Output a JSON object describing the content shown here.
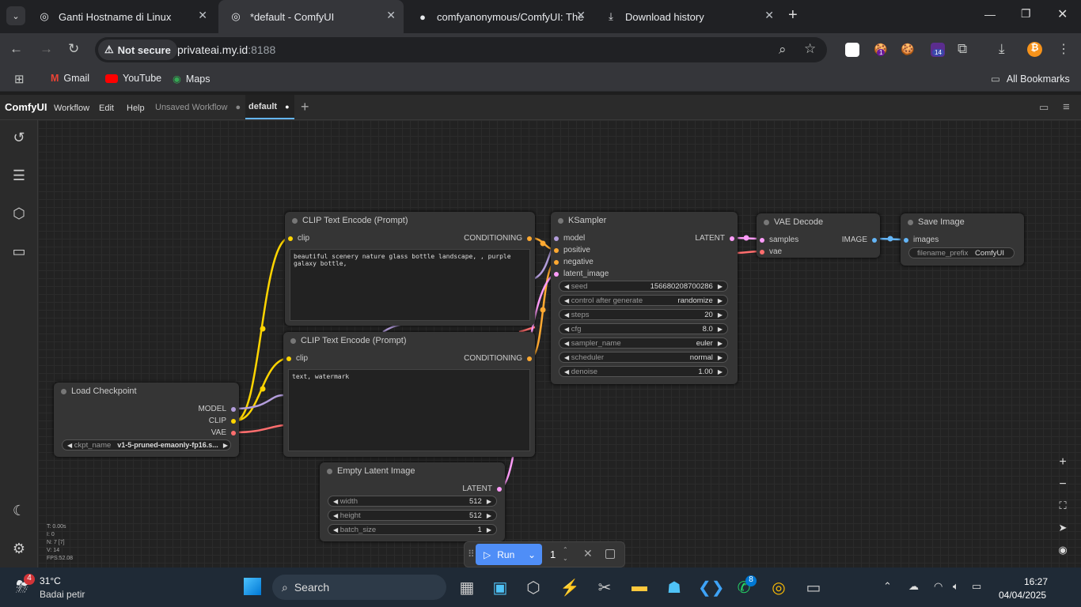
{
  "browser": {
    "tabs": [
      {
        "title": "Ganti Hostname di Linux",
        "active": false
      },
      {
        "title": "*default - ComfyUI",
        "active": true
      },
      {
        "title": "comfyanonymous/ComfyUI: The",
        "active": false
      },
      {
        "title": "Download history",
        "active": false
      }
    ],
    "security": "Not secure",
    "url": "privateai.my.id",
    "port": ":8188",
    "bookmarks": [
      "Gmail",
      "YouTube",
      "Maps"
    ],
    "all_bookmarks": "All Bookmarks",
    "ext_badges": [
      "1",
      "14"
    ]
  },
  "comfy": {
    "logo": "ComfyUI",
    "menu": [
      "Workflow",
      "Edit",
      "Help"
    ],
    "workflow_tabs": [
      "Unsaved Workflow",
      "default"
    ],
    "stats": [
      "T: 0.00s",
      "I: 0",
      "N: 7 [7]",
      "V: 14",
      "FPS:52.08"
    ],
    "run": {
      "label": "Run",
      "count": "1"
    }
  },
  "nodes": {
    "clip1": {
      "title": "CLIP Text Encode (Prompt)",
      "input": "clip",
      "output": "CONDITIONING",
      "text": "beautiful scenery nature glass bottle landscape, , purple galaxy bottle,"
    },
    "clip2": {
      "title": "CLIP Text Encode (Prompt)",
      "input": "clip",
      "output": "CONDITIONING",
      "text": "text, watermark"
    },
    "ksampler": {
      "title": "KSampler",
      "inputs": [
        "model",
        "positive",
        "negative",
        "latent_image"
      ],
      "output": "LATENT",
      "widgets": [
        [
          "seed",
          "156680208700286"
        ],
        [
          "control after generate",
          "randomize"
        ],
        [
          "steps",
          "20"
        ],
        [
          "cfg",
          "8.0"
        ],
        [
          "sampler_name",
          "euler"
        ],
        [
          "scheduler",
          "normal"
        ],
        [
          "denoise",
          "1.00"
        ]
      ]
    },
    "vae": {
      "title": "VAE Decode",
      "inputs": [
        "samples",
        "vae"
      ],
      "output": "IMAGE"
    },
    "save": {
      "title": "Save Image",
      "input": "images",
      "widget": [
        "filename_prefix",
        "ComfyUI"
      ]
    },
    "ckpt": {
      "title": "Load Checkpoint",
      "outputs": [
        "MODEL",
        "CLIP",
        "VAE"
      ],
      "widget": [
        "ckpt_name",
        "v1-5-pruned-emaonly-fp16.s..."
      ]
    },
    "latent": {
      "title": "Empty Latent Image",
      "output": "LATENT",
      "widgets": [
        [
          "width",
          "512"
        ],
        [
          "height",
          "512"
        ],
        [
          "batch_size",
          "1"
        ]
      ]
    }
  },
  "taskbar": {
    "weather_badge": "4",
    "temp": "31°C",
    "weather": "Badai petir",
    "search": "Search",
    "whatsapp_badge": "8",
    "time": "16:27",
    "date": "04/04/2025"
  },
  "colors": {
    "clip": "#ffd500",
    "model": "#b39ddb",
    "vae": "#ff6e6e",
    "latent": "#ff9cf9",
    "cond": "#ffa931",
    "image": "#64b5f6"
  }
}
